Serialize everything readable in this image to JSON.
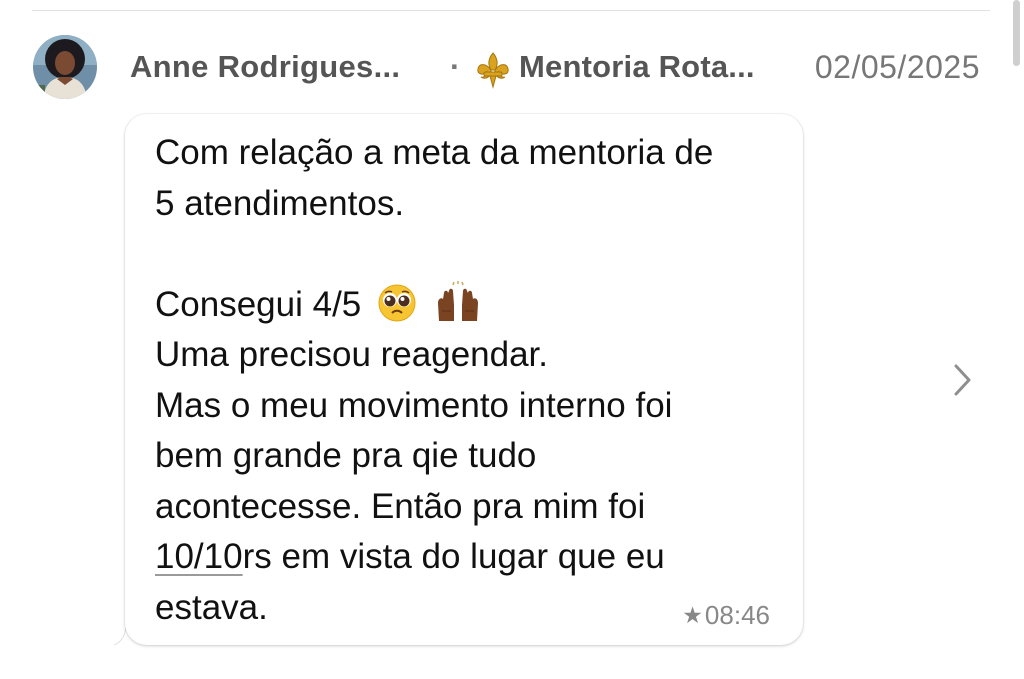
{
  "message": {
    "sender_name": "Anne Rodrigues...",
    "separator": "·",
    "group_icon": "fleur-de-lis-icon",
    "group_name": "Mentoria Rota...",
    "date": "02/05/2025",
    "lines": [
      "Com relação a meta da mentoria de",
      "5 atendimentos.",
      "",
      "Consegui 4/5",
      "Uma precisou reagendar.",
      "Mas o meu movimento interno foi",
      "bem grande pra qie tudo",
      "aconteceSse. Então pra mim foi",
      "10/10",
      "rs em vista do lugar que eu",
      "estava."
    ],
    "emojis": [
      "pleading-face-emoji",
      "raising-hands-emoji"
    ],
    "starred_icon": "star-icon",
    "time": "08:46"
  },
  "colors": {
    "background": "#ffffff",
    "bubble": "#ffffff",
    "header_text": "#555555",
    "date_text": "#777777",
    "message_text": "#111111",
    "meta_text": "#888888"
  },
  "icons": {
    "chevron": "chevron-right-icon",
    "avatar": "avatar"
  }
}
